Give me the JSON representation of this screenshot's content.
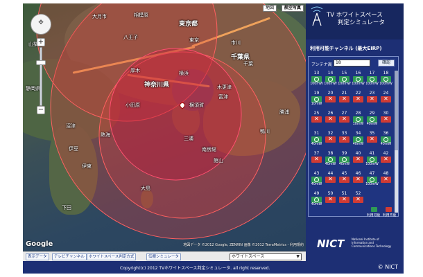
{
  "map": {
    "places": [
      {
        "label": "大月市",
        "cls": ""
      },
      {
        "label": "相模原",
        "cls": ""
      },
      {
        "label": "東京都",
        "cls": "big"
      },
      {
        "label": "千葉県",
        "cls": "big"
      },
      {
        "label": "山梨県",
        "cls": ""
      },
      {
        "label": "八王子",
        "cls": ""
      },
      {
        "label": "東京",
        "cls": ""
      },
      {
        "label": "市川",
        "cls": ""
      },
      {
        "label": "静岡県",
        "cls": ""
      },
      {
        "label": "神奈川県",
        "cls": "big"
      },
      {
        "label": "横浜",
        "cls": ""
      },
      {
        "label": "千葉",
        "cls": ""
      },
      {
        "label": "厚木",
        "cls": ""
      },
      {
        "label": "小田原",
        "cls": ""
      },
      {
        "label": "横須賀",
        "cls": ""
      },
      {
        "label": "富津",
        "cls": ""
      },
      {
        "label": "熱海",
        "cls": ""
      },
      {
        "label": "伊東",
        "cls": ""
      },
      {
        "label": "三浦",
        "cls": ""
      },
      {
        "label": "館山",
        "cls": ""
      },
      {
        "label": "沼津",
        "cls": ""
      },
      {
        "label": "伊豆",
        "cls": ""
      },
      {
        "label": "下田",
        "cls": ""
      },
      {
        "label": "大島",
        "cls": ""
      },
      {
        "label": "鴨川",
        "cls": ""
      },
      {
        "label": "勝浦",
        "cls": ""
      },
      {
        "label": "南房総",
        "cls": ""
      },
      {
        "label": "木更津",
        "cls": ""
      }
    ],
    "map_type_map": "地図",
    "map_type_satellite": "航空写真",
    "copyright": "地図データ ©2012 Google, ZENRIN 画像 ©2012 TerraMetrics - 利用規約",
    "google_logo": "Google"
  },
  "toolbar": {
    "btn_display": "表示データ",
    "btn_tv_channel": "テレビチャンネル",
    "btn_whitespace_method": "ホワイトスペース判定方式",
    "btn_radio_sim": "伝搬シミュレータ",
    "select_value": "ホワイトスペース"
  },
  "footer": {
    "copyright": "Copyright(c) 2012 TVホワイトスペース判定シミュレータ. all right reserved.",
    "nict": "© NICT"
  },
  "panel": {
    "title_line1": "TV ホワイトスペース",
    "title_line2": "判定シミュレータ",
    "subtitle": "利用可能チャンネル (最大EIRP)",
    "antenna_label": "アンテナ高",
    "antenna_value": "18",
    "confirm_button": "確認",
    "legend_ok": "利用可能",
    "legend_ng": "利用不能",
    "nict_logo": "NICT",
    "nict_text": "National Institute of Information and Communications Technology",
    "channels": [
      {
        "num": "13",
        "ok": true,
        "power": "100mW"
      },
      {
        "num": "14",
        "ok": true,
        "power": "100mW"
      },
      {
        "num": "15",
        "ok": true,
        "power": "100mW"
      },
      {
        "num": "16",
        "ok": true,
        "power": "100mW"
      },
      {
        "num": "17",
        "ok": true,
        "power": "100mW"
      },
      {
        "num": "18",
        "ok": true,
        "power": "100mW"
      },
      {
        "num": "19",
        "ok": true,
        "power": "10mW"
      },
      {
        "num": "20",
        "ok": false,
        "power": ""
      },
      {
        "num": "21",
        "ok": false,
        "power": ""
      },
      {
        "num": "22",
        "ok": false,
        "power": ""
      },
      {
        "num": "23",
        "ok": false,
        "power": ""
      },
      {
        "num": "24",
        "ok": false,
        "power": ""
      },
      {
        "num": "25",
        "ok": false,
        "power": ""
      },
      {
        "num": "26",
        "ok": false,
        "power": ""
      },
      {
        "num": "27",
        "ok": false,
        "power": ""
      },
      {
        "num": "28",
        "ok": true,
        "power": "10mW"
      },
      {
        "num": "29",
        "ok": true,
        "power": "40mW"
      },
      {
        "num": "30",
        "ok": false,
        "power": ""
      },
      {
        "num": "31",
        "ok": true,
        "power": "40mW"
      },
      {
        "num": "32",
        "ok": false,
        "power": ""
      },
      {
        "num": "33",
        "ok": false,
        "power": ""
      },
      {
        "num": "34",
        "ok": true,
        "power": "40mW"
      },
      {
        "num": "35",
        "ok": false,
        "power": ""
      },
      {
        "num": "36",
        "ok": true,
        "power": "40mW"
      },
      {
        "num": "37",
        "ok": false,
        "power": ""
      },
      {
        "num": "38",
        "ok": true,
        "power": "40mW"
      },
      {
        "num": "39",
        "ok": true,
        "power": "40mW"
      },
      {
        "num": "40",
        "ok": false,
        "power": ""
      },
      {
        "num": "41",
        "ok": true,
        "power": "100mW"
      },
      {
        "num": "42",
        "ok": false,
        "power": ""
      },
      {
        "num": "43",
        "ok": true,
        "power": "40mW"
      },
      {
        "num": "44",
        "ok": false,
        "power": ""
      },
      {
        "num": "45",
        "ok": false,
        "power": ""
      },
      {
        "num": "46",
        "ok": false,
        "power": ""
      },
      {
        "num": "47",
        "ok": true,
        "power": "100mW"
      },
      {
        "num": "48",
        "ok": false,
        "power": ""
      },
      {
        "num": "49",
        "ok": true,
        "power": "40mW"
      },
      {
        "num": "50",
        "ok": false,
        "power": ""
      },
      {
        "num": "51",
        "ok": false,
        "power": ""
      },
      {
        "num": "52",
        "ok": false,
        "power": ""
      }
    ]
  },
  "colors": {
    "panel_bg": "#1d2f74",
    "ok": "#2f9b55",
    "ng": "#d03b34",
    "coverage": "#e03c3c"
  }
}
